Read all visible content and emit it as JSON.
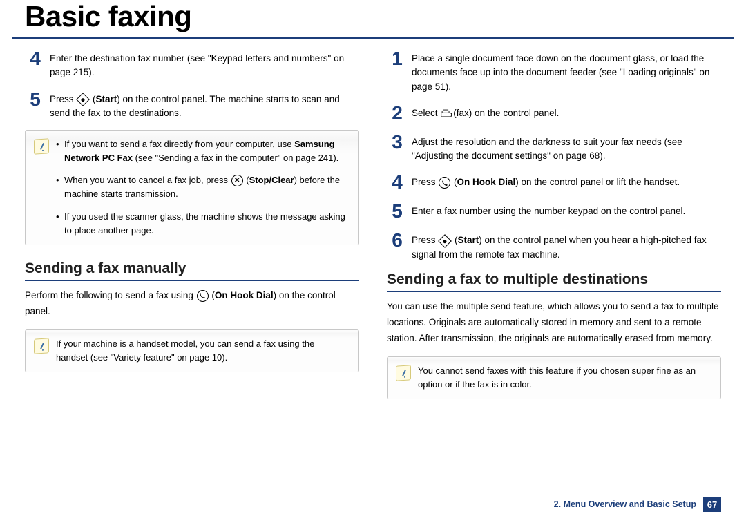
{
  "header": {
    "title": "Basic faxing"
  },
  "left": {
    "steps": [
      {
        "num": "4",
        "html": "Enter the destination fax number (see \"Keypad letters and numbers\" on page 215)."
      },
      {
        "num": "5",
        "html": "Press {diamond} (<b>Start</b>) on the control panel. The machine starts to scan and send the fax to the destinations."
      }
    ],
    "note1": [
      "If you want to send a fax directly from your computer, use <b>Samsung Network PC Fax</b> (see \"Sending a fax in the computer\" on page 241).",
      "When you want to cancel a fax job, press {circle-x} (<b>Stop/Clear</b>) before the machine starts transmission.",
      "If you used the scanner glass, the machine shows the message asking to place another page."
    ],
    "subhead": "Sending a fax manually",
    "body": "Perform the following to send a fax using {circle-phone} (<b>On Hook Dial</b>) on the control panel.",
    "note2": "If your machine is a handset model, you can send a fax using the handset (see \"Variety feature\" on page 10)."
  },
  "right": {
    "steps": [
      {
        "num": "1",
        "html": "Place a single document face down on the document glass, or load the documents face up into the document feeder (see \"Loading originals\" on page 51)."
      },
      {
        "num": "2",
        "html": "Select {fax-icon}(fax) on the control panel."
      },
      {
        "num": "3",
        "html": "Adjust the resolution and the darkness to suit your fax needs (see \"Adjusting the document settings\" on page 68)."
      },
      {
        "num": "4",
        "html": "Press {circle-phone} (<b>On Hook Dial</b>) on the control panel or lift the handset."
      },
      {
        "num": "5",
        "html": "Enter a fax number using the number keypad on the control panel."
      },
      {
        "num": "6",
        "html": "Press {diamond} (<b>Start</b>) on the control panel when you hear a high-pitched fax signal from the remote fax machine."
      }
    ],
    "subhead": "Sending a fax to multiple destinations",
    "body": "You can use the multiple send feature, which allows you to send a fax to multiple locations. Originals are automatically stored in memory and sent to a remote station. After transmission, the originals are automatically erased from memory.",
    "note": "You cannot send faxes with this feature if you chosen super fine as an option or if the fax is in color."
  },
  "footer": {
    "chapter": "2. Menu Overview and Basic Setup",
    "page": "67"
  }
}
